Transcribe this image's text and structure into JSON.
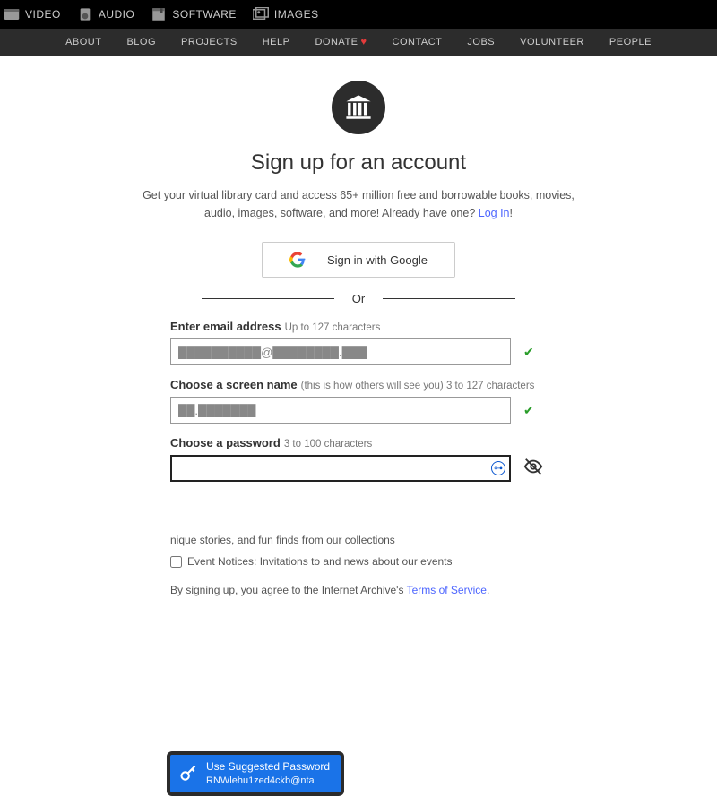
{
  "topbar": [
    {
      "icon": "video-icon",
      "label": "VIDEO"
    },
    {
      "icon": "audio-icon",
      "label": "AUDIO"
    },
    {
      "icon": "software-icon",
      "label": "SOFTWARE"
    },
    {
      "icon": "images-icon",
      "label": "IMAGES"
    }
  ],
  "nav": {
    "about": "ABOUT",
    "blog": "BLOG",
    "projects": "PROJECTS",
    "help": "HELP",
    "donate": "DONATE",
    "contact": "CONTACT",
    "jobs": "JOBS",
    "volunteer": "VOLUNTEER",
    "people": "PEOPLE"
  },
  "page": {
    "title": "Sign up for an account",
    "subtitle_a": "Get your virtual library card and access 65+ million free and borrowable books, movies, audio, images, software, and more! Already have one? ",
    "login_link": "Log In",
    "google_button": "Sign in with Google",
    "or": "Or"
  },
  "form": {
    "email_label": "Enter email address",
    "email_hint": "Up to 127 characters",
    "email_value": "██████████@████████.███",
    "screen_label": "Choose a screen name",
    "screen_hint": "(this is how others will see you) 3 to 127 characters",
    "screen_value": "██.███████",
    "password_label": "Choose a password",
    "password_hint": "3 to 100 characters",
    "password_value": ""
  },
  "suggest": {
    "title": "Use Suggested Password",
    "value": "RNWlehu1zed4ckb@nta"
  },
  "announcements_tail": "nique stories, and fun finds from our collections",
  "event_notices": "Event Notices: Invitations to and news about our events",
  "tos_prefix": "By signing up, you agree to the Internet Archive's ",
  "tos_link": "Terms of Service"
}
